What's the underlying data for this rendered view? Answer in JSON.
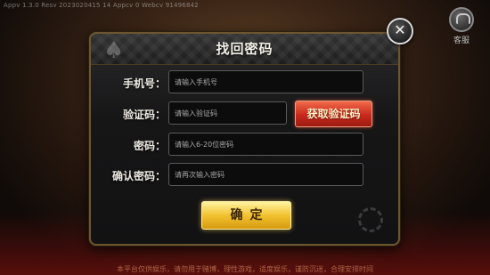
{
  "status_bar": {
    "version_text": "Appv 1.3.0   Resv 2023020415 14   Appcv 0   Webcv 91496842"
  },
  "service": {
    "label": "客服",
    "icon": "headset-icon"
  },
  "dialog": {
    "title": "找回密码",
    "close_symbol": "✕",
    "decor_suit": "♠",
    "fields": {
      "phone": {
        "label": "手机号：",
        "placeholder": "请输入手机号",
        "value": ""
      },
      "code": {
        "label": "验证码：",
        "placeholder": "请输入验证码",
        "value": ""
      },
      "password": {
        "label": "密码：",
        "placeholder": "请输入6-20位密码",
        "value": ""
      },
      "confirm_password": {
        "label": "确认密码：",
        "placeholder": "请再次输入密码",
        "value": ""
      }
    },
    "get_code_button": "获取验证码",
    "confirm_button": "确定"
  },
  "bottom_ticker": {
    "text": "本平台仅供娱乐，请勿用于赌博，理性游戏，适度娱乐，谨防沉迷，合理安排时间"
  },
  "colors": {
    "confirm_button": "#f2c230",
    "code_button": "#c82a1c",
    "dialog_border": "#6b5630"
  }
}
